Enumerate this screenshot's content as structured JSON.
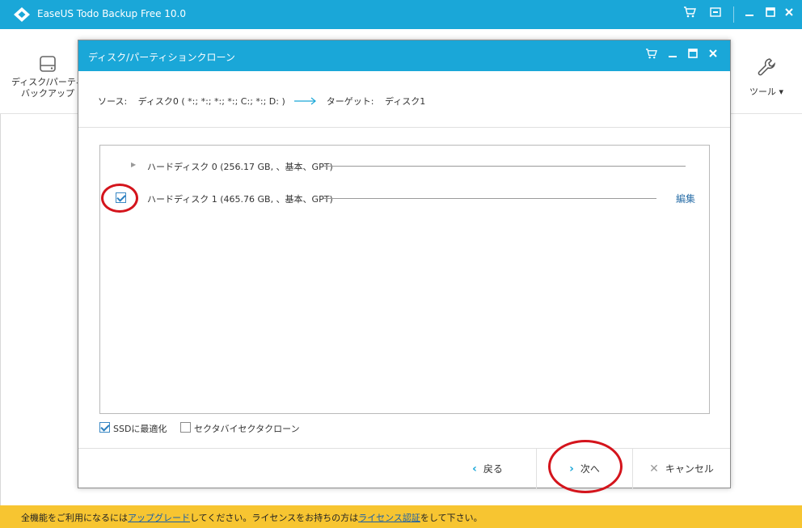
{
  "app": {
    "title": "EaseUS Todo Backup Free 10.0",
    "accent_color": "#1aa7d8",
    "status_color": "#f7c531"
  },
  "toolbar": {
    "disk_tool_label_line1": "ディスク/パーティ",
    "disk_tool_label_line2": "バックアップ",
    "tools_label": "ツール ▾"
  },
  "dialog": {
    "title": "ディスク/パーティションクローン",
    "source_label": "ソース:",
    "source_value": "ディスク0 ( *:; *:; *:; *:; C:; *:; D: )",
    "target_label": "ターゲット:",
    "target_value": "ディスク1",
    "disks": [
      {
        "label": "ハードディスク 0 (256.17 GB, 、基本、GPT)",
        "checked": false
      },
      {
        "label": "ハードディスク 1 (465.76 GB, 、基本、GPT)",
        "checked": true,
        "action": "編集"
      }
    ],
    "options": {
      "ssd_optimize": {
        "label": "SSDに最適化",
        "checked": true
      },
      "sector_clone": {
        "label": "セクタバイセクタクローン",
        "checked": false
      }
    },
    "buttons": {
      "back": "戻る",
      "next": "次へ",
      "cancel": "キャンセル"
    }
  },
  "status": {
    "part1": "全機能をご利用になるには",
    "link1": "アップグレード",
    "part2": "してください。ライセンスをお持ちの方は",
    "link2": "ライセンス認証",
    "part3": "をして下さい。"
  },
  "icons": [
    "logo-icon",
    "cart-icon",
    "window-icon",
    "minimize-icon",
    "maximize-icon",
    "close-icon",
    "hard-drive-icon",
    "wrench-icon",
    "arrow-right-icon",
    "chevron-left-icon",
    "chevron-right-icon",
    "x-icon",
    "triangle-right-icon"
  ]
}
